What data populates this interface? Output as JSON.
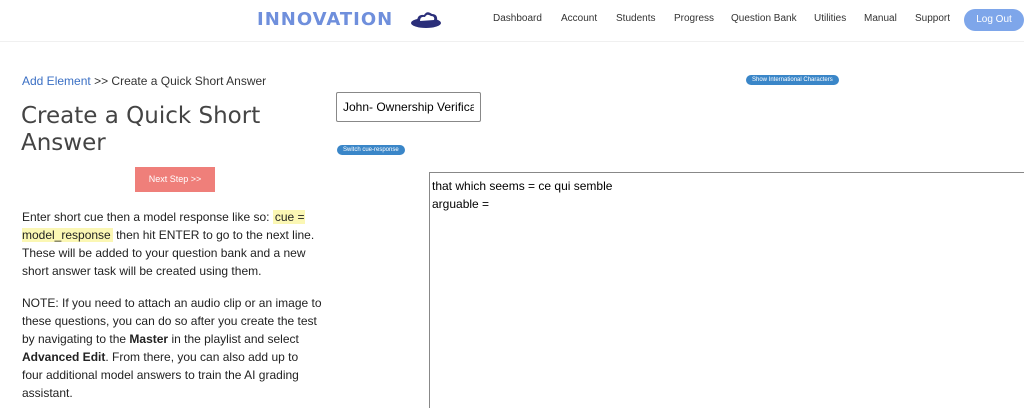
{
  "header": {
    "brand": "INNOVATION",
    "logo_icon": "cloud-logo-icon",
    "nav": [
      "Dashboard",
      "Account",
      "Students",
      "Progress",
      "Question Bank",
      "Utilities",
      "Manual",
      "Support"
    ],
    "logout_label": "Log Out",
    "brand_color": "#6f8fdc",
    "logout_color": "#7ea6ea"
  },
  "breadcrumb": {
    "link": "Add Element",
    "separator": ">>",
    "current": "Create a Quick Short Answer"
  },
  "page_title": "Create a Quick Short Answer",
  "next_step_label": "Next Step >>",
  "instructions": {
    "p1_before": "Enter short cue then a model response like so: ",
    "p1_highlight": "cue = model_response",
    "p1_after": " then hit ENTER to go to the next line. These will be added to your question bank and a new short answer task will be created using them.",
    "p2_a": "NOTE: If you need to attach an audio clip or an image to these questions, you can do so after you create the test by navigating to the ",
    "p2_master": "Master",
    "p2_b": " in the playlist and select ",
    "p2_advanced": "Advanced Edit",
    "p2_c": ". From there, you can also add up to four additional model answers to train the AI grading assistant."
  },
  "editor": {
    "intl_chars_label": "Show International Characters",
    "switch_label": "Switch cue-response",
    "title_value": "John- Ownership Verifica",
    "lines": [
      "that which seems = ce qui semble",
      "arguable = "
    ]
  }
}
